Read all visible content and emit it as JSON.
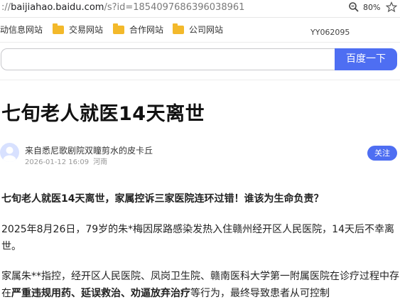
{
  "browser": {
    "url_host": "baijiahao.baidu.com",
    "url_path": "/s?id=1854097686396038961",
    "url_prefix": "://",
    "zoom": "80%"
  },
  "bookmarks": {
    "items": [
      {
        "label": "动信息网站",
        "folder": false
      },
      {
        "label": "交易网站",
        "folder": true
      },
      {
        "label": "合作网站",
        "folder": true
      },
      {
        "label": "公司网站",
        "folder": true
      }
    ],
    "code": "YY062095"
  },
  "search": {
    "value": "",
    "button_label": "百度一下"
  },
  "article": {
    "title": "七旬老人就医14天离世",
    "author": "来自悉尼歌剧院双瞳剪水的皮卡丘",
    "date": "2026-01-12 16:09",
    "location": "河南",
    "follow_label": "关注",
    "lead": "七旬老人就医14天离世，家属控诉三家医院连环过错！谁该为生命负责？",
    "para1": "2025年8月26日，79岁的朱*梅因尿路感染发热入住赣州经开区人民医院，14天后不幸离世。",
    "para2_start": "家属朱**指控，经开区人民医院、凤岗卫生院、赣南医科大学第一附属医院在诊疗过程中存在",
    "para2_bold1": "严重违规用药",
    "para2_sep1": "、",
    "para2_bold2": "延误救治",
    "para2_sep2": "、",
    "para2_bold3": "劝逼放弃治疗",
    "para2_end": "等行为，最终导致患者从可控制"
  },
  "colors": {
    "accent": "#4e6ef2",
    "folder": "#f3b92b"
  }
}
